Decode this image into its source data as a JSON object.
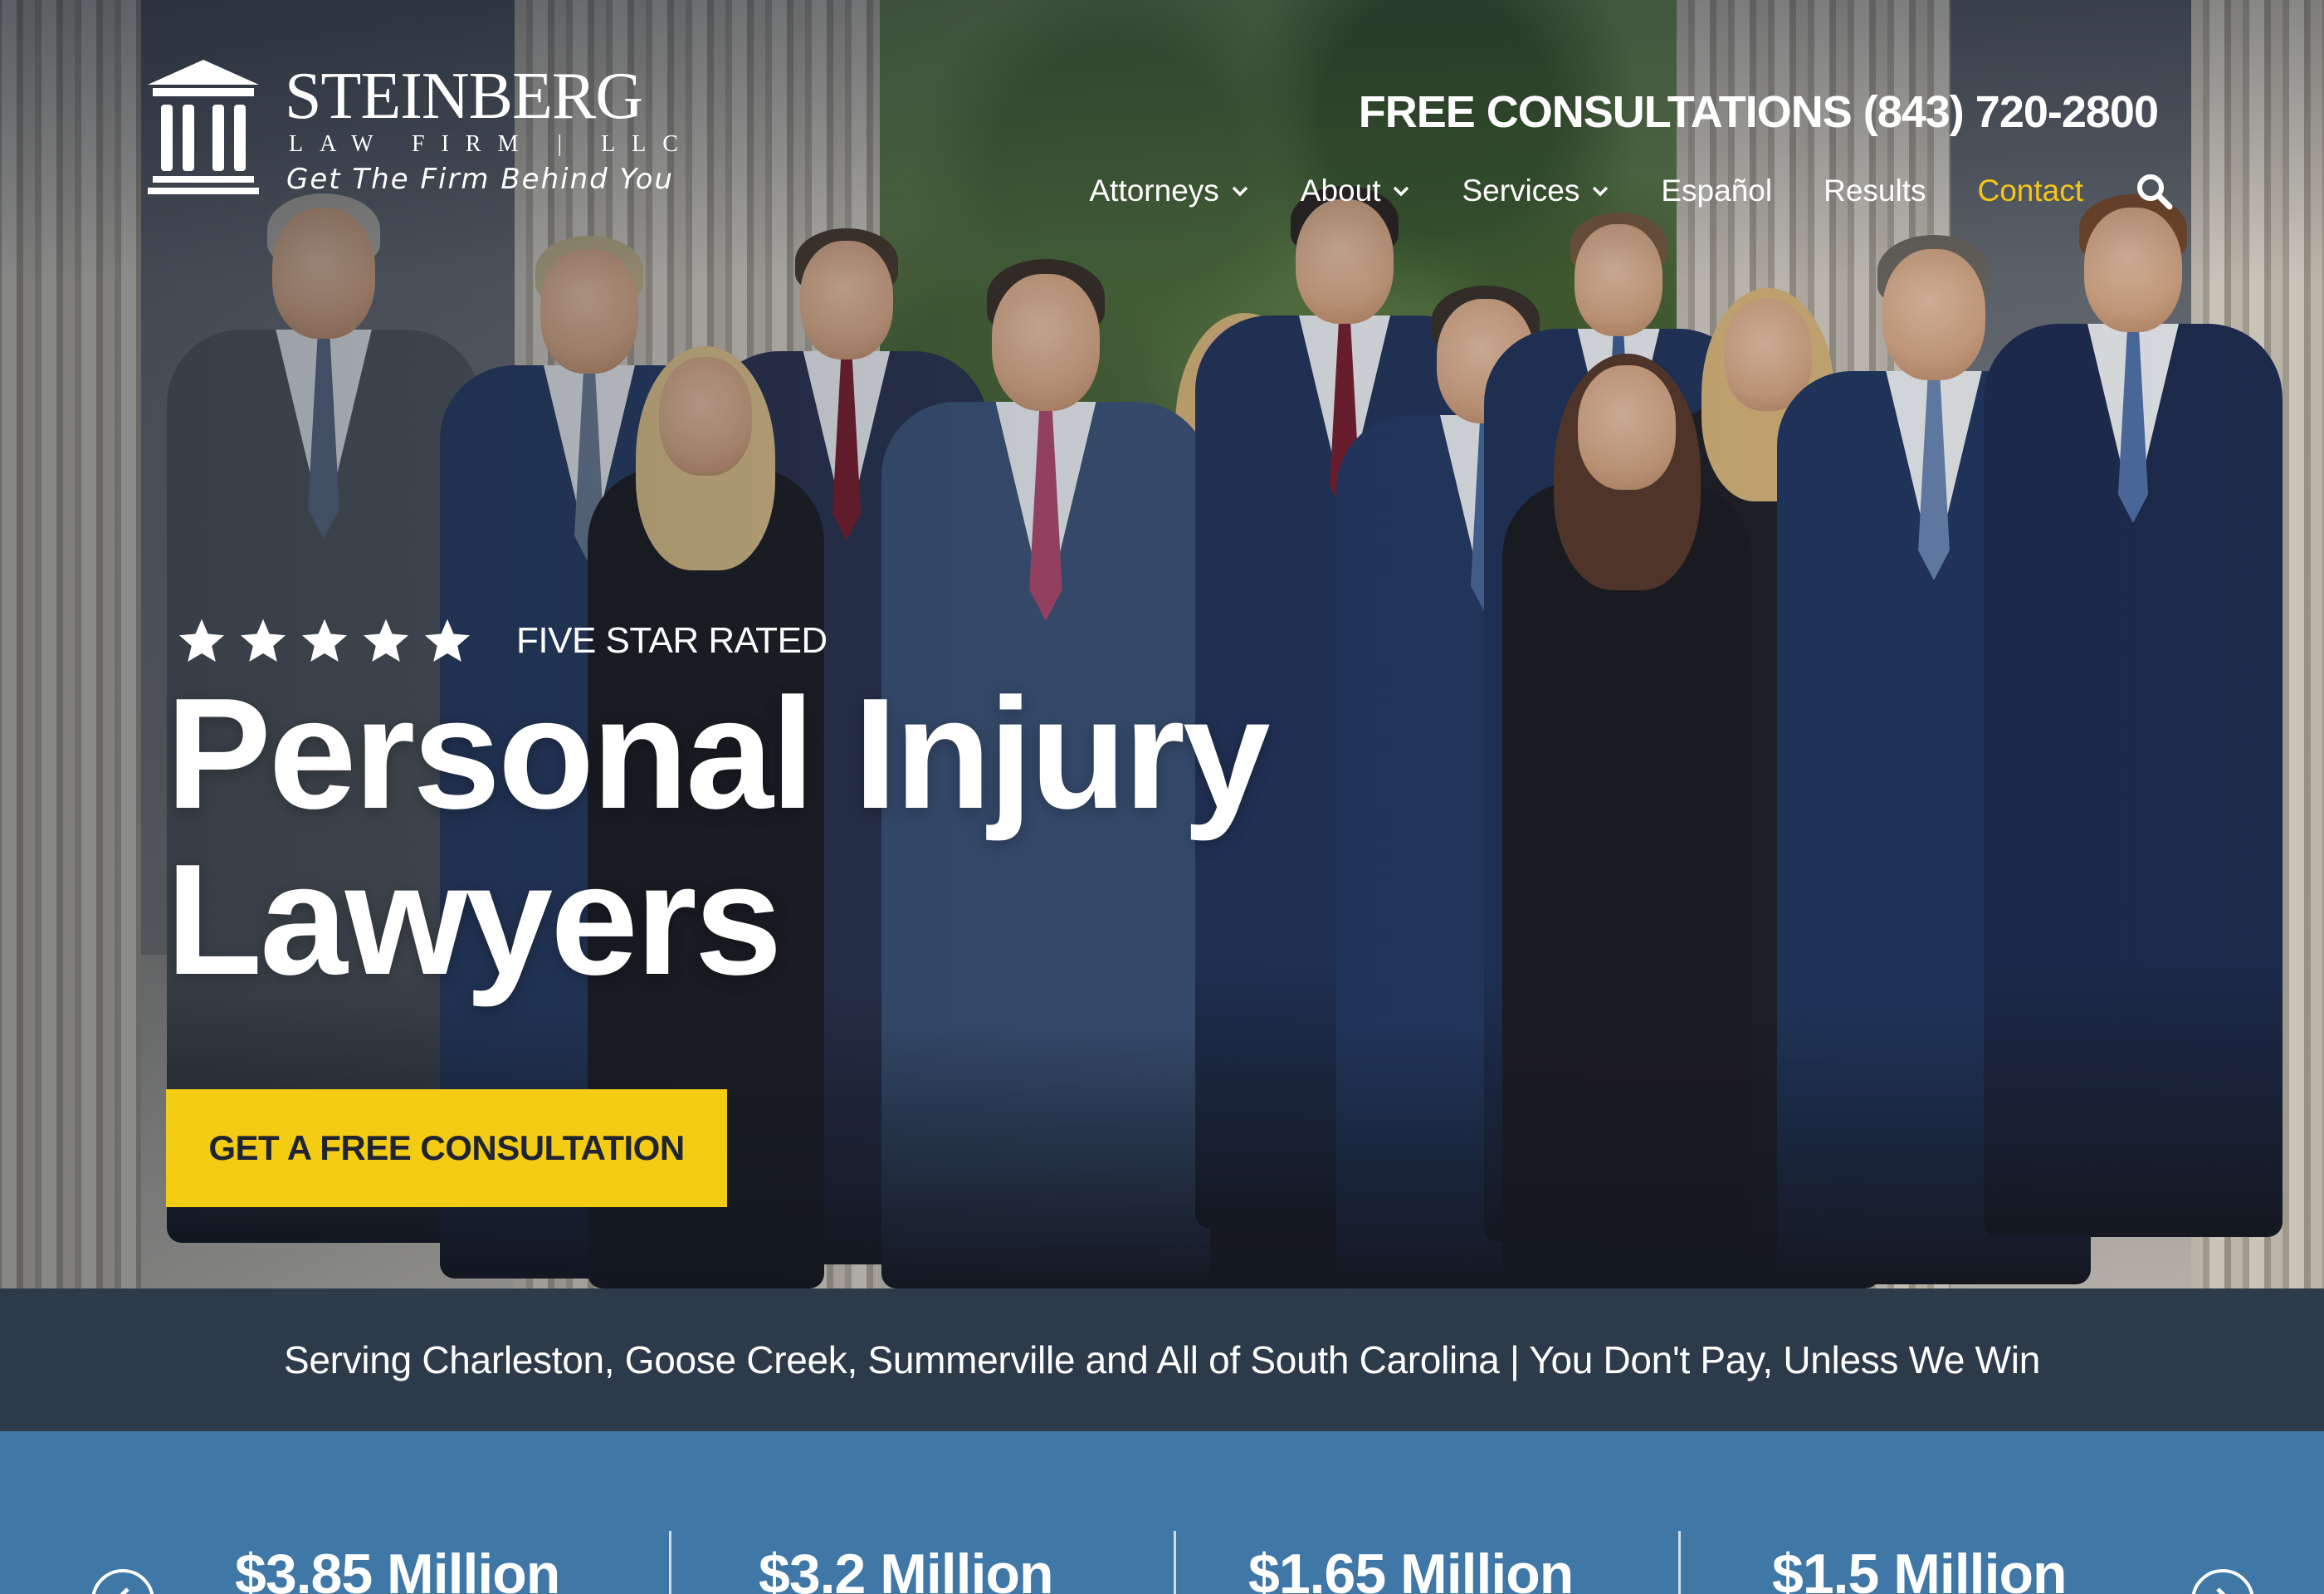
{
  "brand": {
    "name": "STEINBERG",
    "subtitle": "LAW FIRM | LLC",
    "tagline": "Get The Firm Behind You"
  },
  "header": {
    "phone_label": "FREE CONSULTATIONS (843) 720-2800"
  },
  "nav": {
    "items": [
      {
        "label": "Attorneys",
        "dropdown": true
      },
      {
        "label": "About",
        "dropdown": true
      },
      {
        "label": "Services",
        "dropdown": true
      },
      {
        "label": "Español",
        "dropdown": false
      },
      {
        "label": "Results",
        "dropdown": false
      },
      {
        "label": "Contact",
        "dropdown": false,
        "active": true
      }
    ],
    "search_icon": "search-icon"
  },
  "hero": {
    "rating_label": "FIVE STAR RATED",
    "star_count": 5,
    "headline_line1": "Personal Injury",
    "headline_line2": "Lawyers",
    "cta_label": "GET A FREE CONSULTATION"
  },
  "serve_bar": {
    "text": "Serving Charleston, Goose Creek, Summerville and All of South Carolina | You Don't Pay, Unless We Win"
  },
  "results": {
    "items": [
      "$3.85 Million",
      "$3.2 Million",
      "$1.65 Million",
      "$1.5 Million"
    ],
    "prev_icon": "chevron-left-icon",
    "next_icon": "chevron-right-icon"
  },
  "colors": {
    "accent_yellow": "#f5cc14",
    "nav_active": "#f5c518",
    "serve_bar_bg": "#2c3a4a",
    "results_bg": "#3f77a6"
  }
}
